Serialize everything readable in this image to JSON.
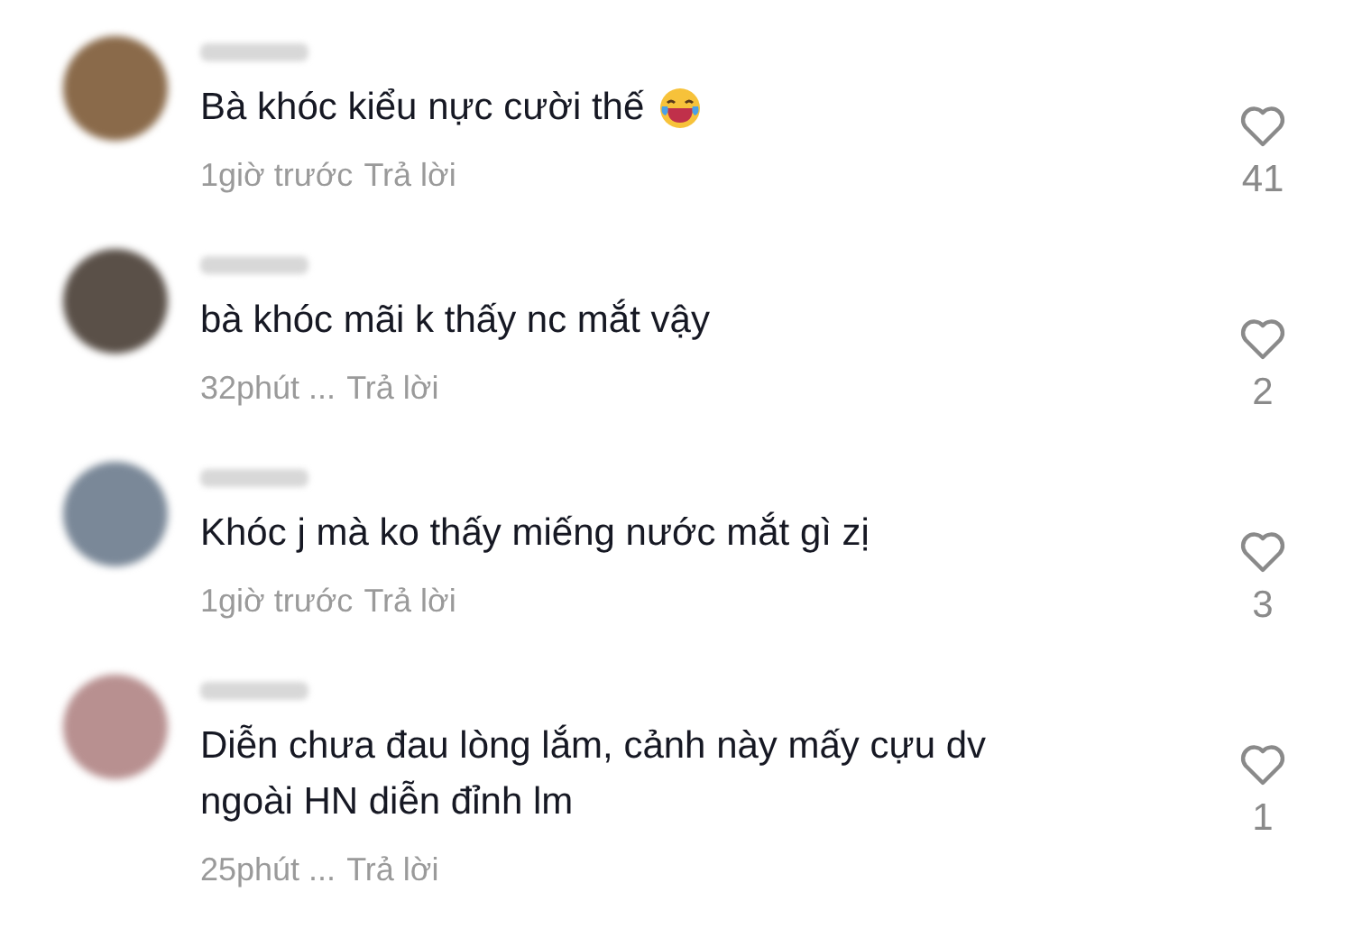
{
  "comments": [
    {
      "text": "Bà khóc kiểu nực cười thế",
      "has_emoji": true,
      "time": "1giờ trước",
      "reply": "Trả lời",
      "likes": "41"
    },
    {
      "text": "bà khóc mãi k thấy nc mắt vậy",
      "has_emoji": false,
      "time": "32phút ...",
      "reply": "Trả lời",
      "likes": "2"
    },
    {
      "text": "Khóc j mà ko thấy miếng nước mắt gì zị",
      "has_emoji": false,
      "time": "1giờ trước",
      "reply": "Trả lời",
      "likes": "3"
    },
    {
      "text": "Diễn chưa đau lòng lắm, cảnh này mấy cựu dv ngoài HN diễn đỉnh lm",
      "has_emoji": false,
      "time": "25phút ...",
      "reply": "Trả lời",
      "likes": "1"
    }
  ]
}
